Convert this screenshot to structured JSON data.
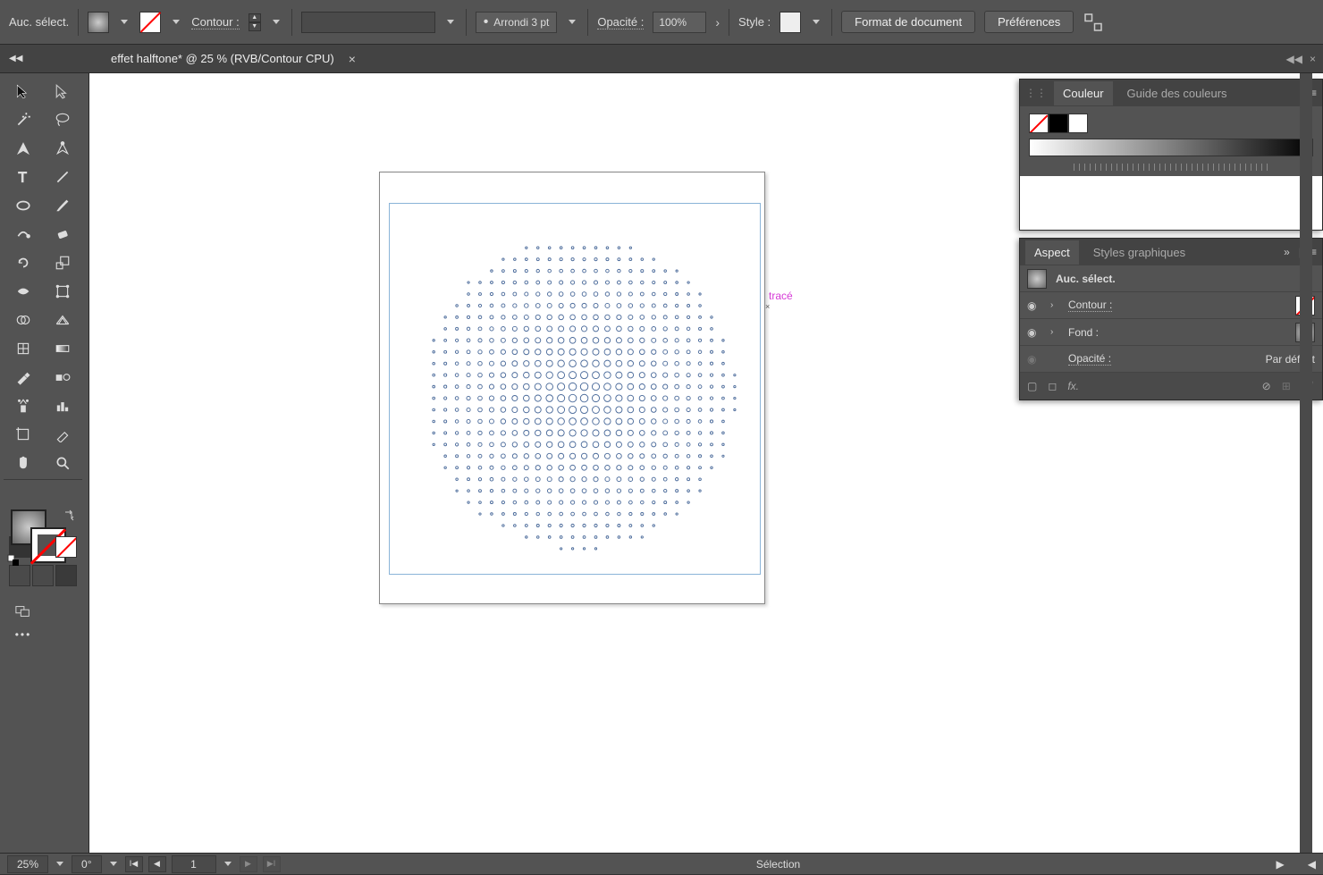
{
  "controlBar": {
    "selectionLabel": "Auc. sélect.",
    "contourLabel": "Contour :",
    "strokeProfile": "Arrondi 3 pt",
    "opacityLabel": "Opacité :",
    "opacityValue": "100%",
    "styleLabel": "Style :",
    "docSetupBtn": "Format de document",
    "prefsBtn": "Préférences"
  },
  "tab": {
    "title": "effet halftone* @ 25 % (RVB/Contour CPU)"
  },
  "canvas": {
    "tag": "tracé"
  },
  "panels": {
    "color": {
      "tab1": "Couleur",
      "tab2": "Guide des couleurs"
    },
    "appearance": {
      "tab1": "Aspect",
      "tab2": "Styles graphiques",
      "noSelection": "Auc. sélect.",
      "contour": "Contour :",
      "fond": "Fond :",
      "opacity": "Opacité :",
      "opacityDefault": "Par défaut",
      "fx": "fx."
    }
  },
  "status": {
    "zoom": "25%",
    "rotation": "0°",
    "page": "1",
    "tool": "Sélection"
  }
}
